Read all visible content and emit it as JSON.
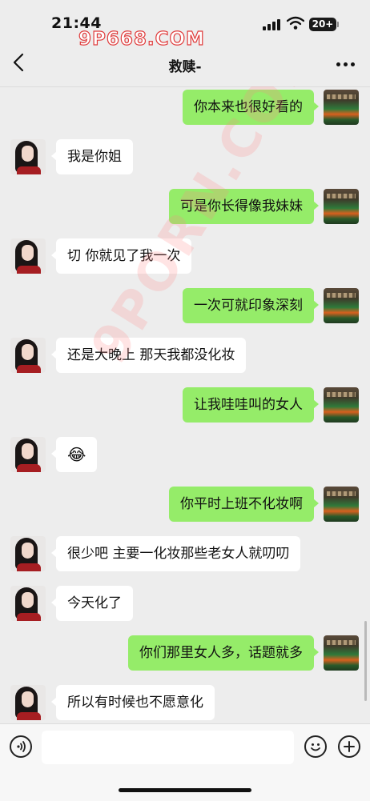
{
  "status_bar": {
    "time": "21:44",
    "battery": "20+"
  },
  "watermark": {
    "top": "9P668.COM",
    "diagonal": "9PORN.COM"
  },
  "nav": {
    "title": "救赎-"
  },
  "messages": [
    {
      "from": "me",
      "text": "你本来也很好看的"
    },
    {
      "from": "her",
      "text": "我是你姐"
    },
    {
      "from": "me",
      "text": "可是你长得像我妹妹"
    },
    {
      "from": "her",
      "text": "切 你就见了我一次"
    },
    {
      "from": "me",
      "text": "一次可就印象深刻"
    },
    {
      "from": "her",
      "text": "还是大晚上 那天我都没化妆"
    },
    {
      "from": "me",
      "text": "让我哇哇叫的女人"
    },
    {
      "from": "her",
      "text": "😂"
    },
    {
      "from": "me",
      "text": "你平时上班不化妆啊"
    },
    {
      "from": "her",
      "text": "很少吧 主要一化妆那些老女人就叨叨"
    },
    {
      "from": "her",
      "text": "今天化了"
    },
    {
      "from": "me",
      "text": "你们那里女人多，话题就多"
    },
    {
      "from": "her",
      "text": "所以有时候也不愿意化"
    }
  ],
  "input": {
    "placeholder": ""
  },
  "colors": {
    "my_bubble": "#95ec69",
    "her_bubble": "#ffffff",
    "background": "#ededed"
  },
  "icons": [
    "back-icon",
    "more-icon",
    "voice-icon",
    "emoji-icon",
    "add-icon"
  ]
}
